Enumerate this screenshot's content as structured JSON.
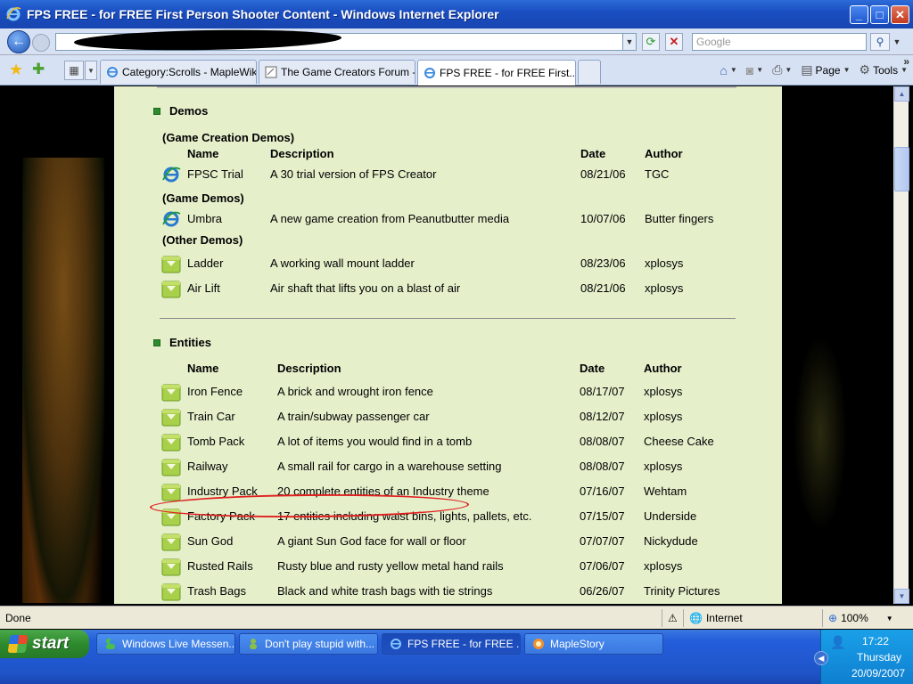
{
  "window": {
    "title": "FPS FREE - for FREE First Person Shooter Content - Windows Internet Explorer"
  },
  "address": {
    "search_placeholder": "Google"
  },
  "tabs": [
    {
      "label": "Category:Scrolls - MapleWiki"
    },
    {
      "label": "The Game Creators Forum - ..."
    },
    {
      "label": "FPS FREE - for FREE First...",
      "active": true
    }
  ],
  "commandbar": {
    "page_label": "Page",
    "tools_label": "Tools"
  },
  "page": {
    "demos": {
      "heading": "Demos",
      "groups": [
        {
          "title": "(Game Creation Demos)"
        },
        {
          "title": "(Game Demos)"
        },
        {
          "title": "(Other Demos)"
        }
      ],
      "columns": {
        "name": "Name",
        "description": "Description",
        "date": "Date",
        "author": "Author"
      },
      "rows": [
        {
          "name": "FPSC Trial",
          "description": "A 30 trial version of FPS Creator",
          "date": "08/21/06",
          "author": "TGC",
          "icon": "ie-icon"
        },
        {
          "name": "Umbra",
          "description": "A new game creation from Peanutbutter media",
          "date": "10/07/06",
          "author": "Butter fingers",
          "icon": "ie-icon"
        },
        {
          "name": "Ladder",
          "description": "A working wall mount ladder",
          "date": "08/23/06",
          "author": "xplosys",
          "icon": "download-icon"
        },
        {
          "name": "Air Lift",
          "description": "Air shaft that lifts you on a blast of air",
          "date": "08/21/06",
          "author": "xplosys",
          "icon": "download-icon"
        }
      ]
    },
    "entities": {
      "heading": "Entities",
      "columns": {
        "name": "Name",
        "description": "Description",
        "date": "Date",
        "author": "Author"
      },
      "rows": [
        {
          "name": "Iron Fence",
          "description": "A brick and wrought iron fence",
          "date": "08/17/07",
          "author": "xplosys"
        },
        {
          "name": "Train Car",
          "description": "A train/subway passenger car",
          "date": "08/12/07",
          "author": "xplosys"
        },
        {
          "name": "Tomb Pack",
          "description": "A lot of items you would find in a tomb",
          "date": "08/08/07",
          "author": "Cheese Cake"
        },
        {
          "name": "Railway",
          "description": "A small rail for cargo in a warehouse setting",
          "date": "08/08/07",
          "author": "xplosys"
        },
        {
          "name": "Industry Pack",
          "description": "20 complete entities of an Industry theme",
          "date": "07/16/07",
          "author": "Wehtam"
        },
        {
          "name": "Factory Pack",
          "description": "17 entities including waist bins, lights, pallets, etc.",
          "date": "07/15/07",
          "author": "Underside"
        },
        {
          "name": "Sun God",
          "description": "A giant Sun God face for wall or floor",
          "date": "07/07/07",
          "author": "Nickydude"
        },
        {
          "name": "Rusted Rails",
          "description": "Rusty blue and rusty yellow metal hand rails",
          "date": "07/06/07",
          "author": "xplosys"
        },
        {
          "name": "Trash Bags",
          "description": "Black and white trash bags with tie strings",
          "date": "06/26/07",
          "author": "Trinity Pictures"
        }
      ]
    }
  },
  "status": {
    "text": "Done",
    "zone": "Internet",
    "zoom": "100%"
  },
  "taskbar": {
    "start_label": "start",
    "items": [
      {
        "label": "Windows Live Messen..."
      },
      {
        "label": "Don't play stupid with..."
      },
      {
        "label": "FPS FREE - for FREE ...",
        "active": true
      },
      {
        "label": "MapleStory"
      }
    ],
    "clock": {
      "time": "17:22",
      "day": "Thursday",
      "date": "20/09/2007"
    }
  },
  "colors": {
    "accent_highlight": "#e02020",
    "page_bg": "#e5f0cb",
    "bullet": "#2e8b2e"
  }
}
